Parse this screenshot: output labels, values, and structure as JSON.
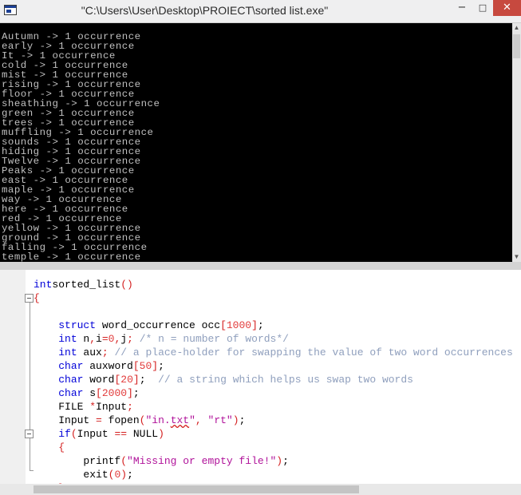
{
  "window": {
    "title": "\"C:\\Users\\User\\Desktop\\PROIECT\\sorted list.exe\"",
    "min_glyph": "−",
    "max_glyph": "□",
    "close_glyph": "✕"
  },
  "console": {
    "lines": [
      "Autumn -> 1 occurrence",
      "early -> 1 occurrence",
      "It -> 1 occurrence",
      "cold -> 1 occurrence",
      "mist -> 1 occurrence",
      "rising -> 1 occurrence",
      "floor -> 1 occurrence",
      "sheathing -> 1 occurrence",
      "green -> 1 occurrence",
      "trees -> 1 occurrence",
      "muffling -> 1 occurrence",
      "sounds -> 1 occurrence",
      "hiding -> 1 occurrence",
      "Twelve -> 1 occurrence",
      "Peaks -> 1 occurrence",
      "east -> 1 occurrence",
      "maple -> 1 occurrence",
      "way -> 1 occurrence",
      "here -> 1 occurrence",
      "red -> 1 occurrence",
      "yellow -> 1 occurrence",
      "ground -> 1 occurrence",
      "falling -> 1 occurrence",
      "temple -> 1 occurrence"
    ],
    "scroll_up": "▲",
    "scroll_down": "▼"
  },
  "editor": {
    "lines": [
      {
        "indent": "",
        "tokens": [
          [
            "kw",
            "int"
          ],
          [
            "",
            "sorted_list"
          ],
          [
            "op",
            "()"
          ]
        ]
      },
      {
        "indent": "",
        "tokens": [
          [
            "op",
            "{"
          ]
        ]
      },
      {
        "indent": "",
        "tokens": []
      },
      {
        "indent": "    ",
        "tokens": [
          [
            "kw",
            "struct"
          ],
          [
            "",
            " word_occurrence occ"
          ],
          [
            "op",
            "["
          ],
          [
            "num",
            "1000"
          ],
          [
            "op",
            "]"
          ],
          [
            "",
            ";"
          ]
        ]
      },
      {
        "indent": "    ",
        "tokens": [
          [
            "kw",
            "int"
          ],
          [
            "",
            " n"
          ],
          [
            "op",
            ","
          ],
          [
            "",
            "i"
          ],
          [
            "op",
            "="
          ],
          [
            "num",
            "0"
          ],
          [
            "op",
            ","
          ],
          [
            "",
            "j"
          ],
          [
            "op",
            ";"
          ],
          [
            "",
            " "
          ],
          [
            "cmt",
            "/* n = number of words*/"
          ]
        ]
      },
      {
        "indent": "    ",
        "tokens": [
          [
            "kw",
            "int"
          ],
          [
            "",
            " aux"
          ],
          [
            "op",
            ";"
          ],
          [
            "",
            " "
          ],
          [
            "cmt",
            "// a place-holder for swapping the value of two word occurrences"
          ]
        ]
      },
      {
        "indent": "    ",
        "tokens": [
          [
            "kw",
            "char"
          ],
          [
            "",
            " auxword"
          ],
          [
            "op",
            "["
          ],
          [
            "num",
            "50"
          ],
          [
            "op",
            "]"
          ],
          [
            "",
            ";"
          ]
        ]
      },
      {
        "indent": "    ",
        "tokens": [
          [
            "kw",
            "char"
          ],
          [
            "",
            " word"
          ],
          [
            "op",
            "["
          ],
          [
            "num",
            "20"
          ],
          [
            "op",
            "]"
          ],
          [
            "",
            ";  "
          ],
          [
            "cmt",
            "// a string which helps us swap two words"
          ]
        ]
      },
      {
        "indent": "    ",
        "tokens": [
          [
            "kw",
            "char"
          ],
          [
            "",
            " s"
          ],
          [
            "op",
            "["
          ],
          [
            "num",
            "2000"
          ],
          [
            "op",
            "]"
          ],
          [
            "",
            ";"
          ]
        ]
      },
      {
        "indent": "    ",
        "tokens": [
          [
            "",
            "FILE "
          ],
          [
            "op",
            "*"
          ],
          [
            "",
            "Input"
          ],
          [
            "op",
            ";"
          ]
        ]
      },
      {
        "indent": "    ",
        "tokens": [
          [
            "",
            "Input "
          ],
          [
            "op",
            "="
          ],
          [
            "",
            " fopen"
          ],
          [
            "op",
            "("
          ],
          [
            "str",
            "\"in."
          ],
          [
            "str squig",
            "txt"
          ],
          [
            "str",
            "\""
          ],
          [
            "op",
            ","
          ],
          [
            "",
            " "
          ],
          [
            "str",
            "\"rt\""
          ],
          [
            "op",
            ")"
          ],
          [
            "",
            ";"
          ]
        ]
      },
      {
        "indent": "    ",
        "tokens": [
          [
            "kw",
            "if"
          ],
          [
            "op",
            "("
          ],
          [
            "",
            "Input "
          ],
          [
            "op",
            "=="
          ],
          [
            "",
            " NULL"
          ],
          [
            "op",
            ")"
          ]
        ]
      },
      {
        "indent": "    ",
        "tokens": [
          [
            "op",
            "{"
          ]
        ]
      },
      {
        "indent": "        ",
        "tokens": [
          [
            "",
            "printf"
          ],
          [
            "op",
            "("
          ],
          [
            "str",
            "\"Missing or empty file!\""
          ],
          [
            "op",
            ")"
          ],
          [
            "",
            ";"
          ]
        ]
      },
      {
        "indent": "        ",
        "tokens": [
          [
            "",
            "exit"
          ],
          [
            "op",
            "("
          ],
          [
            "num",
            "0"
          ],
          [
            "op",
            ")"
          ],
          [
            "",
            ";"
          ]
        ]
      },
      {
        "indent": "    ",
        "tokens": [
          [
            "op",
            "}"
          ]
        ]
      }
    ]
  }
}
